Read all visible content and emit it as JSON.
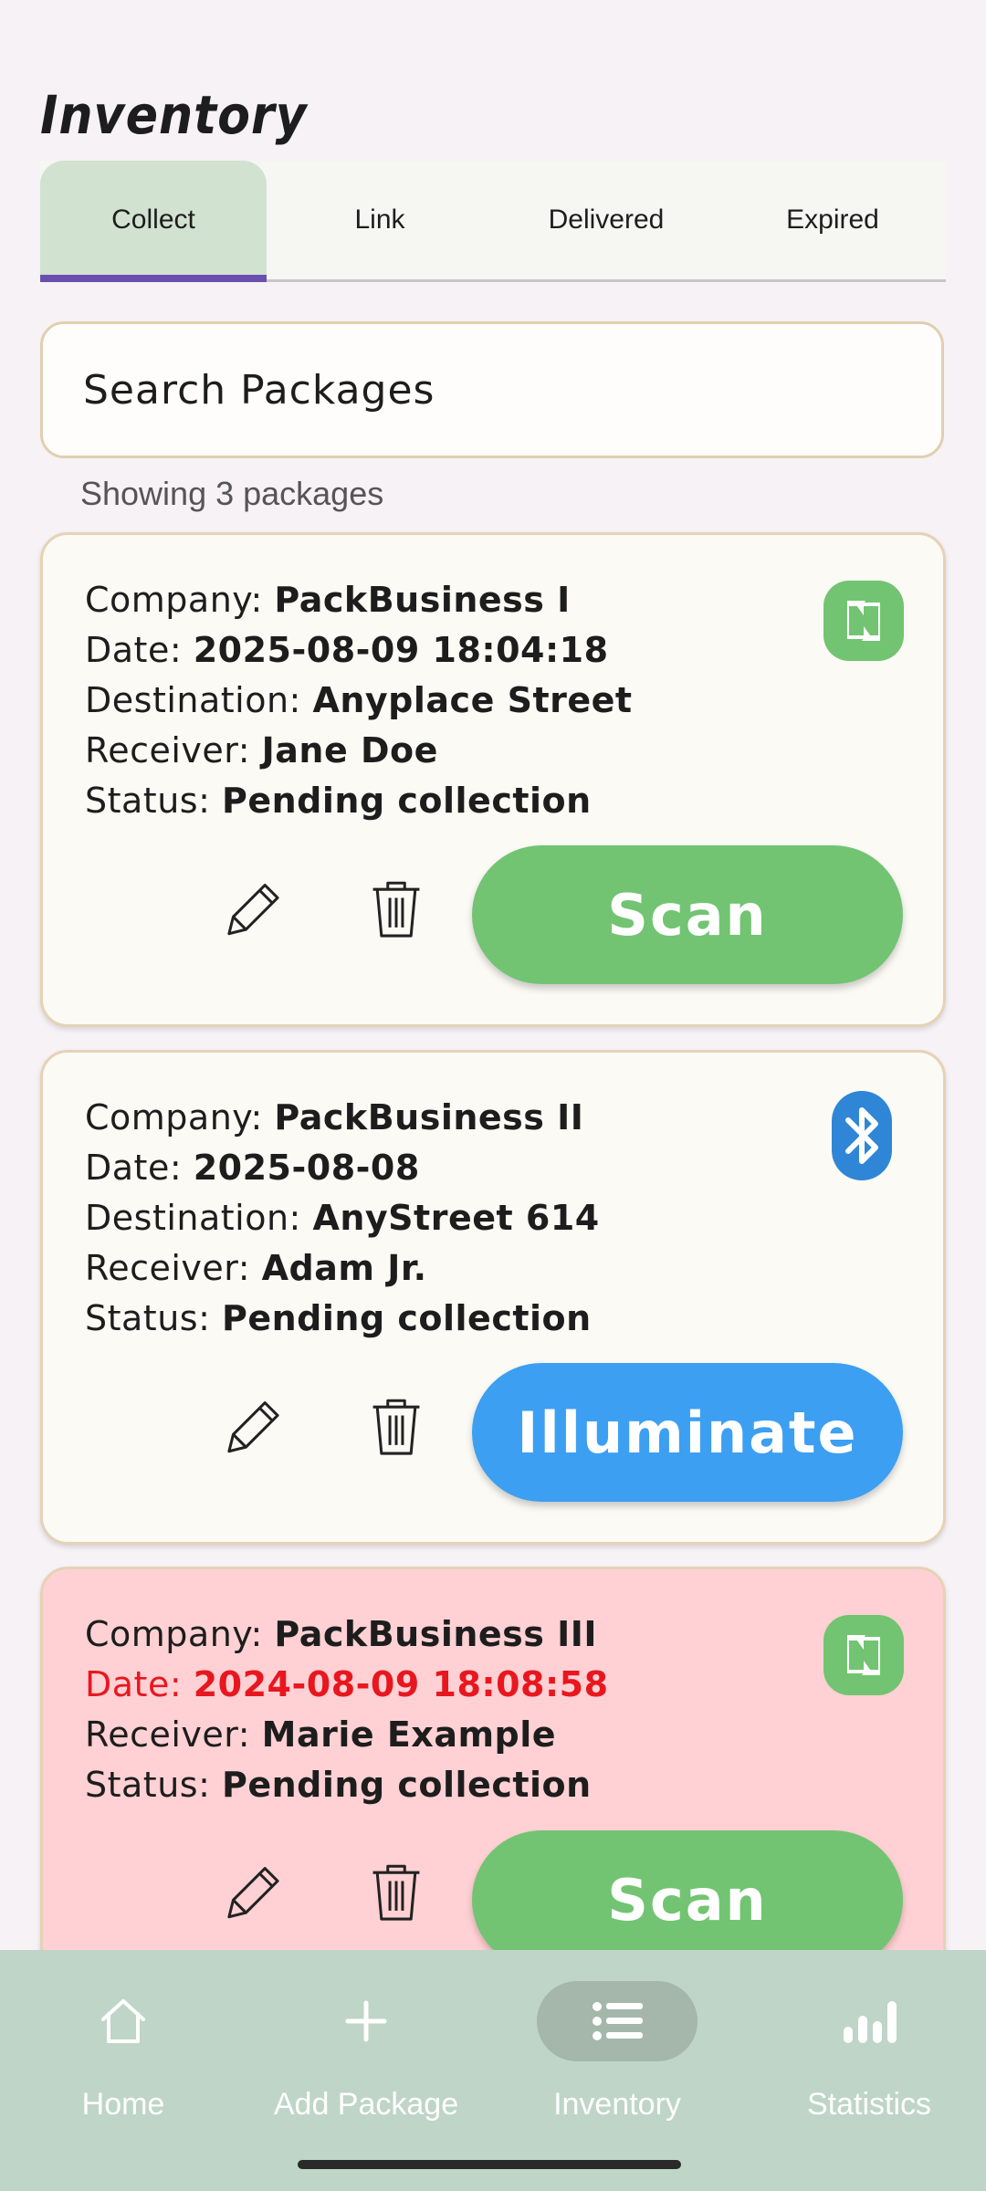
{
  "header": {
    "title": "Inventory"
  },
  "tabs": [
    {
      "label": "Collect",
      "active": true
    },
    {
      "label": "Link",
      "active": false
    },
    {
      "label": "Delivered",
      "active": false
    },
    {
      "label": "Expired",
      "active": false
    }
  ],
  "search": {
    "placeholder": "Search Packages"
  },
  "result_count": "Showing 3 packages",
  "cards": [
    {
      "company_label": "Company:",
      "company": "PackBusiness I",
      "date_label": "Date:",
      "date": "2025-08-09 18:04:18",
      "destination_label": "Destination:",
      "destination": "Anyplace Street",
      "receiver_label": "Receiver:",
      "receiver": "Jane Doe",
      "status_label": "Status:",
      "status": "Pending collection",
      "tech_icon": "nfc-icon",
      "action": "Scan",
      "action_color": "#72c472"
    },
    {
      "company_label": "Company:",
      "company": "PackBusiness II",
      "date_label": "Date:",
      "date": "2025-08-08",
      "destination_label": "Destination:",
      "destination": "AnyStreet 614",
      "receiver_label": "Receiver:",
      "receiver": "Adam Jr.",
      "status_label": "Status:",
      "status": "Pending collection",
      "tech_icon": "bluetooth-icon",
      "action": "Illuminate",
      "action_color": "#3c9ff2"
    },
    {
      "company_label": "Company:",
      "company": "PackBusiness III",
      "date_label": "Date:",
      "date": "2024-08-09 18:08:58",
      "receiver_label": "Receiver:",
      "receiver": "Marie Example",
      "status_label": "Status:",
      "status": "Pending collection",
      "tech_icon": "nfc-icon",
      "action": "Scan",
      "action_color": "#72c472",
      "expired": true,
      "date_color": "#e8171f"
    }
  ],
  "bottom_nav": [
    {
      "label": "Home",
      "icon": "home-icon"
    },
    {
      "label": "Add Package",
      "icon": "plus-icon"
    },
    {
      "label": "Inventory",
      "icon": "list-icon",
      "active": true
    },
    {
      "label": "Statistics",
      "icon": "bar-chart-icon"
    }
  ],
  "colors": {
    "nfc_green": "#72c472",
    "bluetooth_blue": "#2f86d6",
    "tab_indicator": "#6a4fb0",
    "expired_card": "#ffd1d4",
    "nav_background": "#bfd5c7"
  }
}
